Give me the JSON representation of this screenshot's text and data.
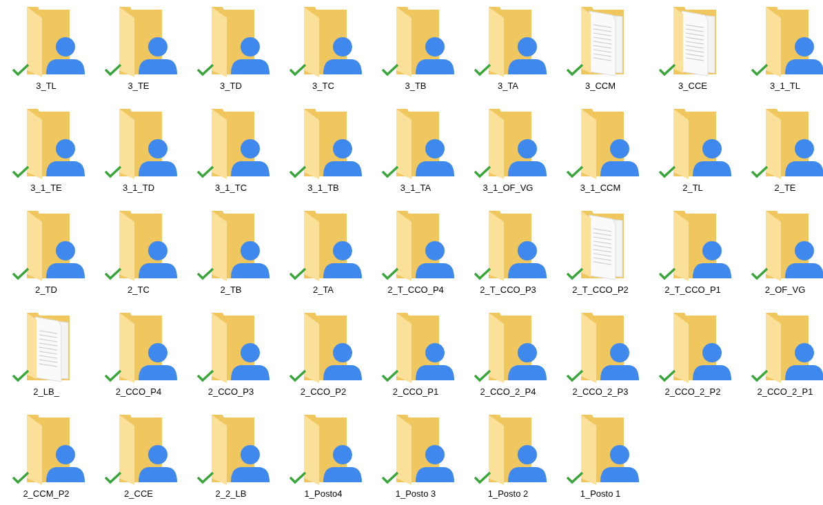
{
  "folders": [
    {
      "name": "3_TL",
      "kind": "shared",
      "synced": true
    },
    {
      "name": "3_TE",
      "kind": "shared",
      "synced": true
    },
    {
      "name": "3_TD",
      "kind": "shared",
      "synced": true
    },
    {
      "name": "3_TC",
      "kind": "shared",
      "synced": true
    },
    {
      "name": "3_TB",
      "kind": "shared",
      "synced": true
    },
    {
      "name": "3_TA",
      "kind": "shared",
      "synced": true
    },
    {
      "name": "3_CCM",
      "kind": "documents",
      "synced": true
    },
    {
      "name": "3_CCE",
      "kind": "documents",
      "synced": true
    },
    {
      "name": "3_1_TL",
      "kind": "shared",
      "synced": true
    },
    {
      "name": "3_1_TE",
      "kind": "shared",
      "synced": true
    },
    {
      "name": "3_1_TD",
      "kind": "shared",
      "synced": true
    },
    {
      "name": "3_1_TC",
      "kind": "shared",
      "synced": true
    },
    {
      "name": "3_1_TB",
      "kind": "shared",
      "synced": true
    },
    {
      "name": "3_1_TA",
      "kind": "shared",
      "synced": true
    },
    {
      "name": "3_1_OF_VG",
      "kind": "shared",
      "synced": true
    },
    {
      "name": "3_1_CCM",
      "kind": "shared",
      "synced": true
    },
    {
      "name": "2_TL",
      "kind": "shared",
      "synced": true
    },
    {
      "name": "2_TE",
      "kind": "shared",
      "synced": true
    },
    {
      "name": "2_TD",
      "kind": "shared",
      "synced": true
    },
    {
      "name": "2_TC",
      "kind": "shared",
      "synced": true
    },
    {
      "name": "2_TB",
      "kind": "shared",
      "synced": true
    },
    {
      "name": "2_TA",
      "kind": "shared",
      "synced": true
    },
    {
      "name": "2_T_CCO_P4",
      "kind": "shared",
      "synced": true
    },
    {
      "name": "2_T_CCO_P3",
      "kind": "shared",
      "synced": true
    },
    {
      "name": "2_T_CCO_P2",
      "kind": "documents",
      "synced": true
    },
    {
      "name": "2_T_CCO_P1",
      "kind": "shared",
      "synced": true
    },
    {
      "name": "2_OF_VG",
      "kind": "shared",
      "synced": true
    },
    {
      "name": "2_LB_",
      "kind": "documents",
      "synced": true
    },
    {
      "name": "2_CCO_P4",
      "kind": "shared",
      "synced": true
    },
    {
      "name": "2_CCO_P3",
      "kind": "shared",
      "synced": true
    },
    {
      "name": "2_CCO_P2",
      "kind": "shared",
      "synced": true
    },
    {
      "name": "2_CCO_P1",
      "kind": "shared",
      "synced": true
    },
    {
      "name": "2_CCO_2_P4",
      "kind": "shared",
      "synced": true
    },
    {
      "name": "2_CCO_2_P3",
      "kind": "shared",
      "synced": true
    },
    {
      "name": "2_CCO_2_P2",
      "kind": "shared",
      "synced": true
    },
    {
      "name": "2_CCO_2_P1",
      "kind": "shared",
      "synced": true
    },
    {
      "name": "2_CCM_P2",
      "kind": "shared",
      "synced": true
    },
    {
      "name": "2_CCE",
      "kind": "shared",
      "synced": true
    },
    {
      "name": "2_2_LB",
      "kind": "shared",
      "synced": true
    },
    {
      "name": "1_Posto4",
      "kind": "shared",
      "synced": true
    },
    {
      "name": "1_Posto 3",
      "kind": "shared",
      "synced": true
    },
    {
      "name": "1_Posto 2",
      "kind": "shared",
      "synced": true
    },
    {
      "name": "1_Posto 1",
      "kind": "shared",
      "synced": true
    }
  ]
}
